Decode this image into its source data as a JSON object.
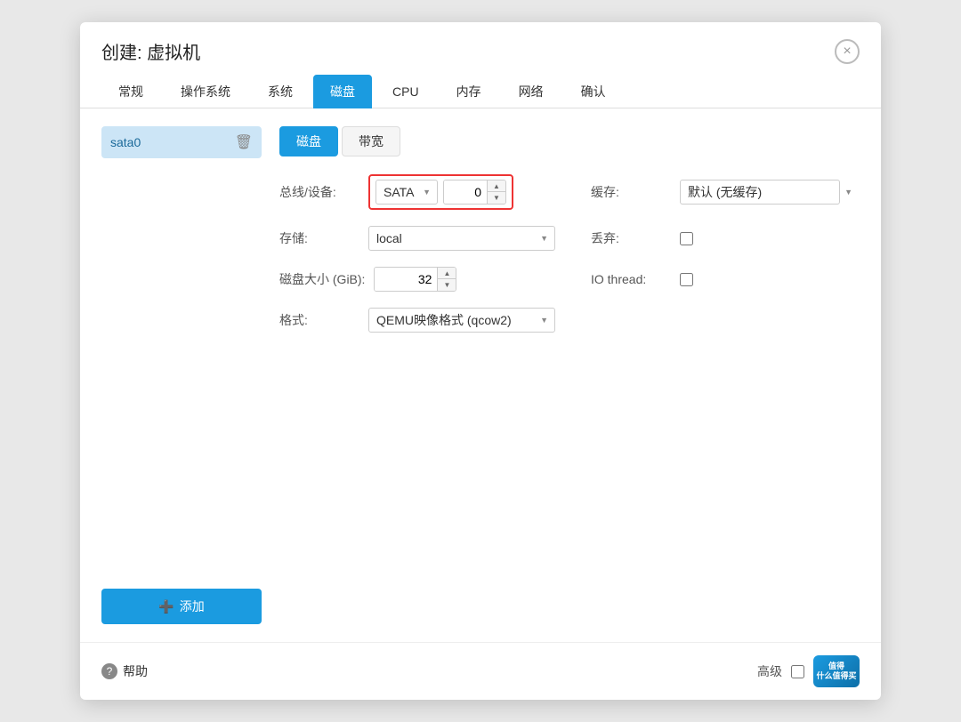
{
  "dialog": {
    "title": "创建: 虚拟机",
    "close_label": "×"
  },
  "nav": {
    "tabs": [
      {
        "id": "general",
        "label": "常规",
        "active": false
      },
      {
        "id": "os",
        "label": "操作系统",
        "active": false
      },
      {
        "id": "system",
        "label": "系统",
        "active": false
      },
      {
        "id": "disk",
        "label": "磁盘",
        "active": true
      },
      {
        "id": "cpu",
        "label": "CPU",
        "active": false
      },
      {
        "id": "memory",
        "label": "内存",
        "active": false
      },
      {
        "id": "network",
        "label": "网络",
        "active": false
      },
      {
        "id": "confirm",
        "label": "确认",
        "active": false
      }
    ]
  },
  "sidebar": {
    "disk_item_label": "sata0",
    "add_button_label": "添加"
  },
  "sub_tabs": [
    {
      "id": "disk",
      "label": "磁盘",
      "active": true
    },
    {
      "id": "bandwidth",
      "label": "带宽",
      "active": false
    }
  ],
  "form": {
    "bus_label": "总线/设备:",
    "bus_value": "SATA",
    "bus_number": "0",
    "storage_label": "存储:",
    "storage_value": "local",
    "disk_size_label": "磁盘大小 (GiB):",
    "disk_size_value": "32",
    "format_label": "格式:",
    "format_value": "QEMU映像格式 (qco…",
    "cache_label": "缓存:",
    "cache_value": "默认 (无缓存)",
    "discard_label": "丢弃:",
    "io_thread_label": "IO thread:"
  },
  "footer": {
    "help_label": "帮助",
    "advanced_label": "高级",
    "watermark_line1": "值得",
    "watermark_line2": "什么值得买"
  }
}
